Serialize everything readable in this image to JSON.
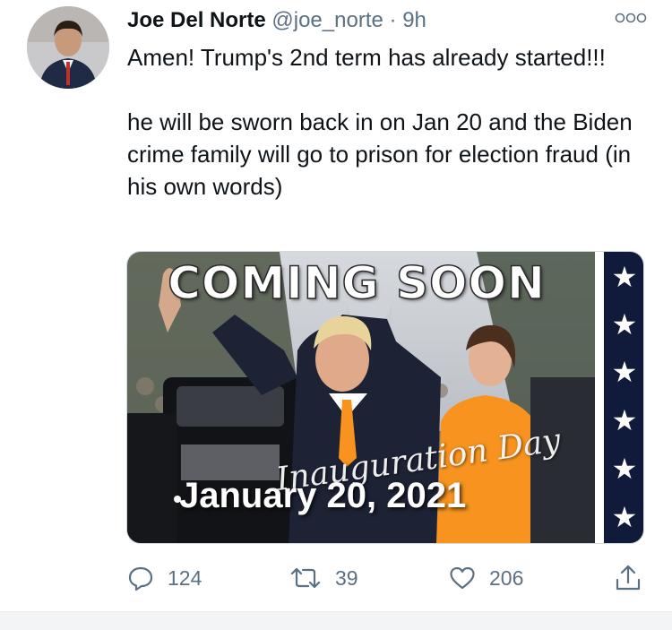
{
  "tweet": {
    "author_name": "Joe Del Norte",
    "handle": "@joe_norte",
    "separator": "·",
    "time": "9h",
    "text": "Amen! Trump's 2nd term has already started!!!\n\nhe will be sworn back in on Jan 20 and the Biden crime family will go to prison for election fraud (in his own words)"
  },
  "media": {
    "headline": "COMING SOON",
    "script_title": "Inauguration Day",
    "date": "January 20, 2021",
    "stars": [
      "★",
      "★",
      "★",
      "★",
      "★",
      "★"
    ],
    "colors": {
      "orange": "#f7931e",
      "navy": "#101a3a"
    }
  },
  "actions": {
    "reply_icon": "reply-icon",
    "reply_count": "124",
    "retweet_icon": "retweet-icon",
    "retweet_count": "39",
    "like_icon": "heart-icon",
    "like_count": "206",
    "share_icon": "share-icon"
  },
  "colors": {
    "text": "#0f1419",
    "muted": "#5b7083",
    "border": "#cfd9de"
  }
}
